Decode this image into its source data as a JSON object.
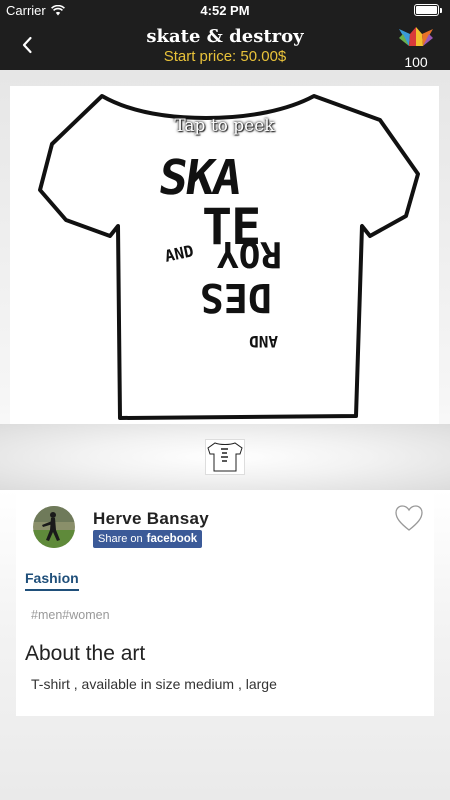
{
  "status_bar": {
    "carrier": "Carrier",
    "time": "4:52 PM"
  },
  "nav": {
    "title": "skate & destroy",
    "subtitle": "Start price:  50.00$",
    "coin_count": "100",
    "back_icon": "chevron-left-icon",
    "coin_icon": "colorful-logo-icon"
  },
  "artwork": {
    "peek_label": "Tap to peek",
    "shirt_text_lines": [
      "SKA",
      "TE",
      "AND",
      "DES",
      "ROY",
      "AND"
    ]
  },
  "author": {
    "name": "Herve Bansay",
    "share_prefix": "Share on",
    "share_brand": "facebook",
    "favorite_icon": "heart-outline-icon"
  },
  "category": "Fashion",
  "tags": [
    "#men",
    "#women"
  ],
  "about": {
    "title": "About the art",
    "text": "T-shirt , available in size medium , large"
  },
  "colors": {
    "nav_background": "#1e1e1e",
    "price_accent": "#e8c23a",
    "facebook_blue": "#3b5a98",
    "category_blue": "#1f4f7a"
  }
}
